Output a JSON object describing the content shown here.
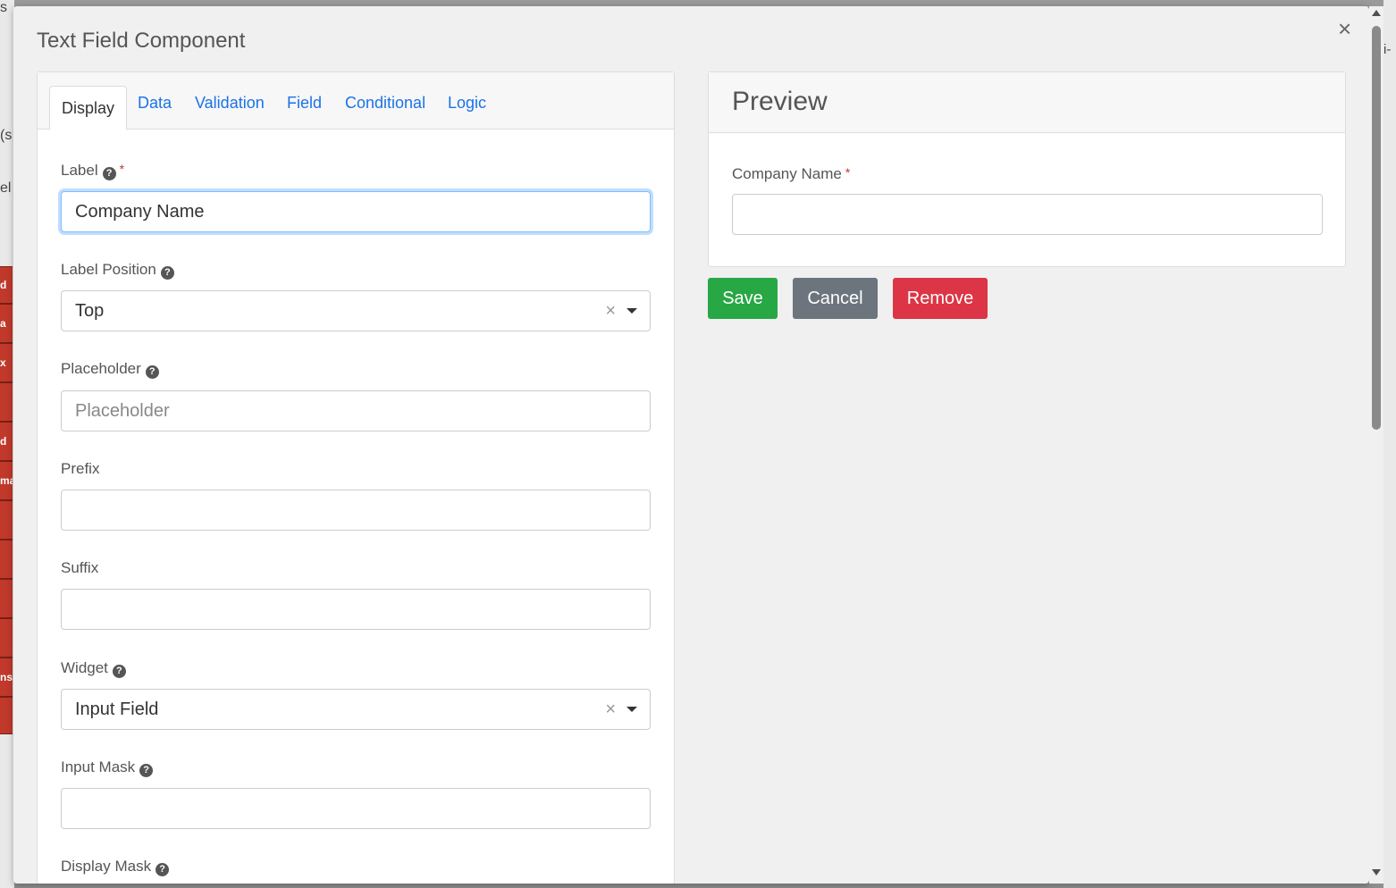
{
  "background": {
    "fragments": [
      "s",
      "(s",
      "el",
      "d",
      "a",
      "x",
      "d",
      "ma",
      "ns"
    ],
    "right_fragment": "i-"
  },
  "modal": {
    "title": "Text Field Component",
    "close_glyph": "×"
  },
  "tabs": [
    {
      "label": "Display",
      "active": true
    },
    {
      "label": "Data",
      "active": false
    },
    {
      "label": "Validation",
      "active": false
    },
    {
      "label": "Field",
      "active": false
    },
    {
      "label": "Conditional",
      "active": false
    },
    {
      "label": "Logic",
      "active": false
    }
  ],
  "form": {
    "label": {
      "label": "Label",
      "required_mark": "*",
      "value": "Company Name"
    },
    "label_position": {
      "label": "Label Position",
      "value": "Top",
      "clear_glyph": "×"
    },
    "placeholder": {
      "label": "Placeholder",
      "placeholder": "Placeholder"
    },
    "prefix": {
      "label": "Prefix",
      "value": ""
    },
    "suffix": {
      "label": "Suffix",
      "value": ""
    },
    "widget": {
      "label": "Widget",
      "value": "Input Field",
      "clear_glyph": "×"
    },
    "input_mask": {
      "label": "Input Mask",
      "value": ""
    },
    "display_mask": {
      "label": "Display Mask"
    }
  },
  "preview": {
    "title": "Preview",
    "field_label": "Company Name",
    "required_mark": "*"
  },
  "actions": {
    "save": "Save",
    "cancel": "Cancel",
    "remove": "Remove"
  },
  "colors": {
    "link": "#1a73e8",
    "save": "#28a745",
    "cancel": "#6c757d",
    "remove": "#dc3545",
    "required": "#c0392b"
  }
}
